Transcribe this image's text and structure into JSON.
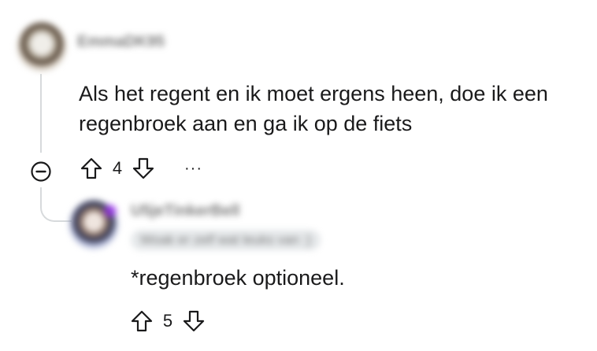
{
  "comments": [
    {
      "username": "EmmaDK95",
      "text": "Als het regent en ik moet ergens heen, doe ik een regenbroek aan en ga ik op de fiets",
      "votes": "4",
      "more_label": "···"
    },
    {
      "username": "U5jeTinkerBell",
      "flair": "Woak er zelf wat leuks van :)",
      "text": "*regenbroek optioneel.",
      "votes": "5"
    }
  ],
  "icons": {
    "upvote": "arrow-up-outline-icon",
    "downvote": "arrow-down-outline-icon",
    "collapse": "minus-circle-icon",
    "more": "ellipsis-icon"
  },
  "colors": {
    "text": "#1a1a1b",
    "thread_line": "#d7dadc",
    "muted": "#7c7c7c"
  }
}
